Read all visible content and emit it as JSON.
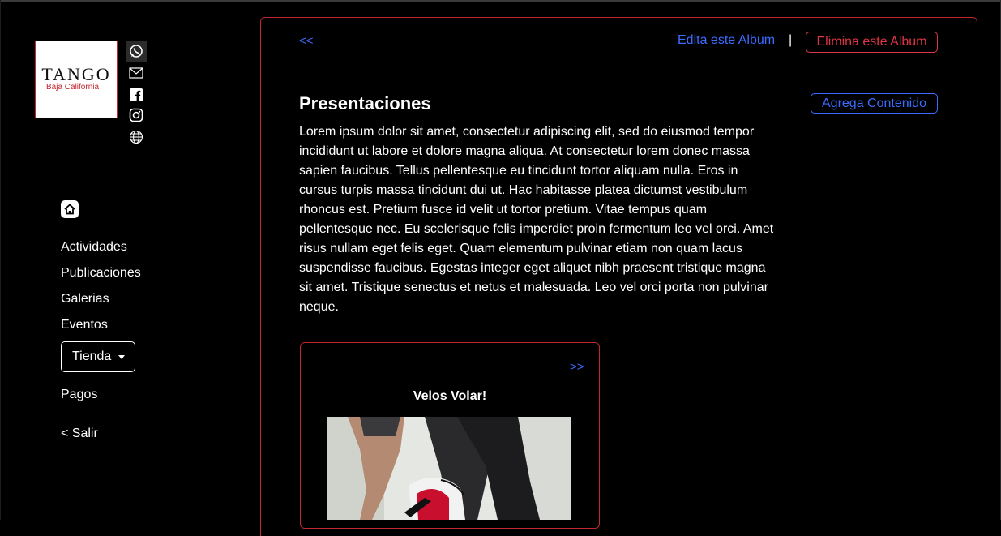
{
  "sidebar": {
    "logo_text": "TANGO",
    "logo_subtext": "Baja California",
    "social_icons": [
      "whatsapp-icon",
      "mail-icon",
      "facebook-icon",
      "instagram-icon",
      "globe-icon"
    ],
    "nav": [
      {
        "label": "Actividades"
      },
      {
        "label": "Publicaciones"
      },
      {
        "label": "Galerias"
      },
      {
        "label": "Eventos"
      }
    ],
    "tienda_label": "Tienda",
    "pagos_label": "Pagos",
    "salir_label": "< Salir"
  },
  "album": {
    "back_label": "<<",
    "edit_label": "Edita este Album",
    "separator": "|",
    "delete_label": "Elimina este Album",
    "add_content_label": "Agrega Contenido",
    "title": "Presentaciones",
    "description": "Lorem ipsum dolor sit amet, consectetur adipiscing elit, sed do eiusmod tempor incididunt ut labore et dolore magna aliqua. At consectetur lorem donec massa sapien faucibus. Tellus pellentesque eu tincidunt tortor aliquam nulla. Eros in cursus turpis massa tincidunt dui ut. Hac habitasse platea dictumst vestibulum rhoncus est. Pretium fusce id velit ut tortor pretium. Vitae tempus quam pellentesque nec. Eu scelerisque felis imperdiet proin fermentum leo vel orci. Amet risus nullam eget felis eget. Quam elementum pulvinar etiam non quam lacus suspendisse faucibus. Egestas integer eget aliquet nibh praesent tristique magna sit amet. Tristique senectus et netus et malesuada. Leo vel orci porta non pulvinar neque."
  },
  "card": {
    "next_label": ">>",
    "title": "Velos Volar!"
  },
  "colors": {
    "accent_blue": "#3b6cff",
    "accent_red": "#c1272d",
    "danger": "#dc3545",
    "background": "#000000"
  }
}
